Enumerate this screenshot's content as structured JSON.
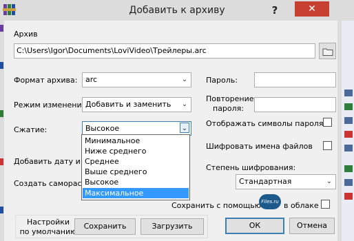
{
  "window": {
    "title": "Добавить к архиву",
    "help": "?",
    "close": "✕"
  },
  "archive": {
    "label": "Архив",
    "path": "C:\\Users\\Igor\\Documents\\LoviVideo\\Трейлеры.arc"
  },
  "format": {
    "label": "Формат архива:",
    "value": "arc"
  },
  "mode": {
    "label": "Режим изменения:",
    "value": "Добавить и заменить"
  },
  "compression": {
    "label": "Сжатие:",
    "value": "Высокое",
    "options": [
      "Минимальное",
      "Ниже среднего",
      "Среднее",
      "Выше среднего",
      "Высокое",
      "Максимальное"
    ],
    "highlighted": "Максимальное"
  },
  "add_date_label": "Добавить дату и вр",
  "create_sfx_label": "Создать самораспак",
  "password": {
    "label": "Пароль:",
    "repeat_label_1": "Повторение",
    "repeat_label_2": "пароля:",
    "show_chars": "Отображать символы пароля",
    "encrypt_names": "Шифровать имена файлов",
    "strength_label": "Степень шифрования:",
    "strength_value": "Стандартная"
  },
  "cloud": {
    "save_with": "Сохранить с помощью",
    "logo": "Files.ru",
    "in_cloud": "в облаке"
  },
  "defaults": {
    "label_1": "Настройки",
    "label_2": "по умолчанию",
    "save": "Сохранить",
    "load": "Загрузить"
  },
  "buttons": {
    "ok": "ОК",
    "cancel": "Отмена"
  },
  "colors": {
    "close": "#c84031",
    "selection": "#3399ff",
    "accent_border": "#3c7fb1"
  }
}
